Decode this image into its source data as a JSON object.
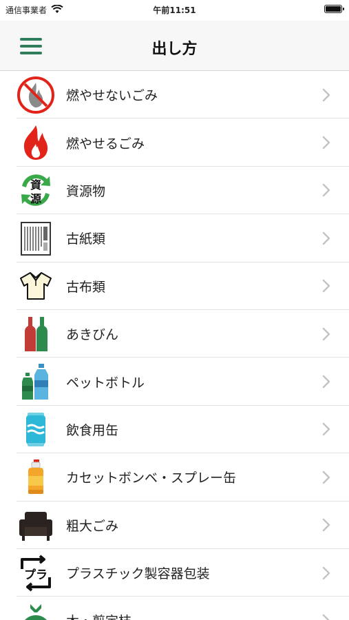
{
  "status": {
    "carrier": "通信事業者",
    "time": "午前11:51"
  },
  "nav": {
    "title": "出し方"
  },
  "items": [
    {
      "label": "燃やせないごみ",
      "icon": "non-burnable-icon"
    },
    {
      "label": "燃やせるごみ",
      "icon": "burnable-icon"
    },
    {
      "label": "資源物",
      "icon": "resources-icon",
      "icon_text_top": "資",
      "icon_text_bottom": "源"
    },
    {
      "label": "古紙類",
      "icon": "paper-icon"
    },
    {
      "label": "古布類",
      "icon": "cloth-icon"
    },
    {
      "label": "あきびん",
      "icon": "bottles-icon"
    },
    {
      "label": "ペットボトル",
      "icon": "pet-bottle-icon"
    },
    {
      "label": "飲食用缶",
      "icon": "can-icon"
    },
    {
      "label": "カセットボンベ・スプレー缶",
      "icon": "spray-can-icon"
    },
    {
      "label": "粗大ごみ",
      "icon": "sofa-icon"
    },
    {
      "label": "プラスチック製容器包装",
      "icon": "plastic-mark-icon",
      "icon_text": "プラ"
    },
    {
      "label": "木・剪定枝",
      "icon": "bag-icon"
    }
  ],
  "colors": {
    "accent": "#2f7d5a",
    "danger": "#e2231a",
    "recycle_green": "#3aa94a"
  }
}
